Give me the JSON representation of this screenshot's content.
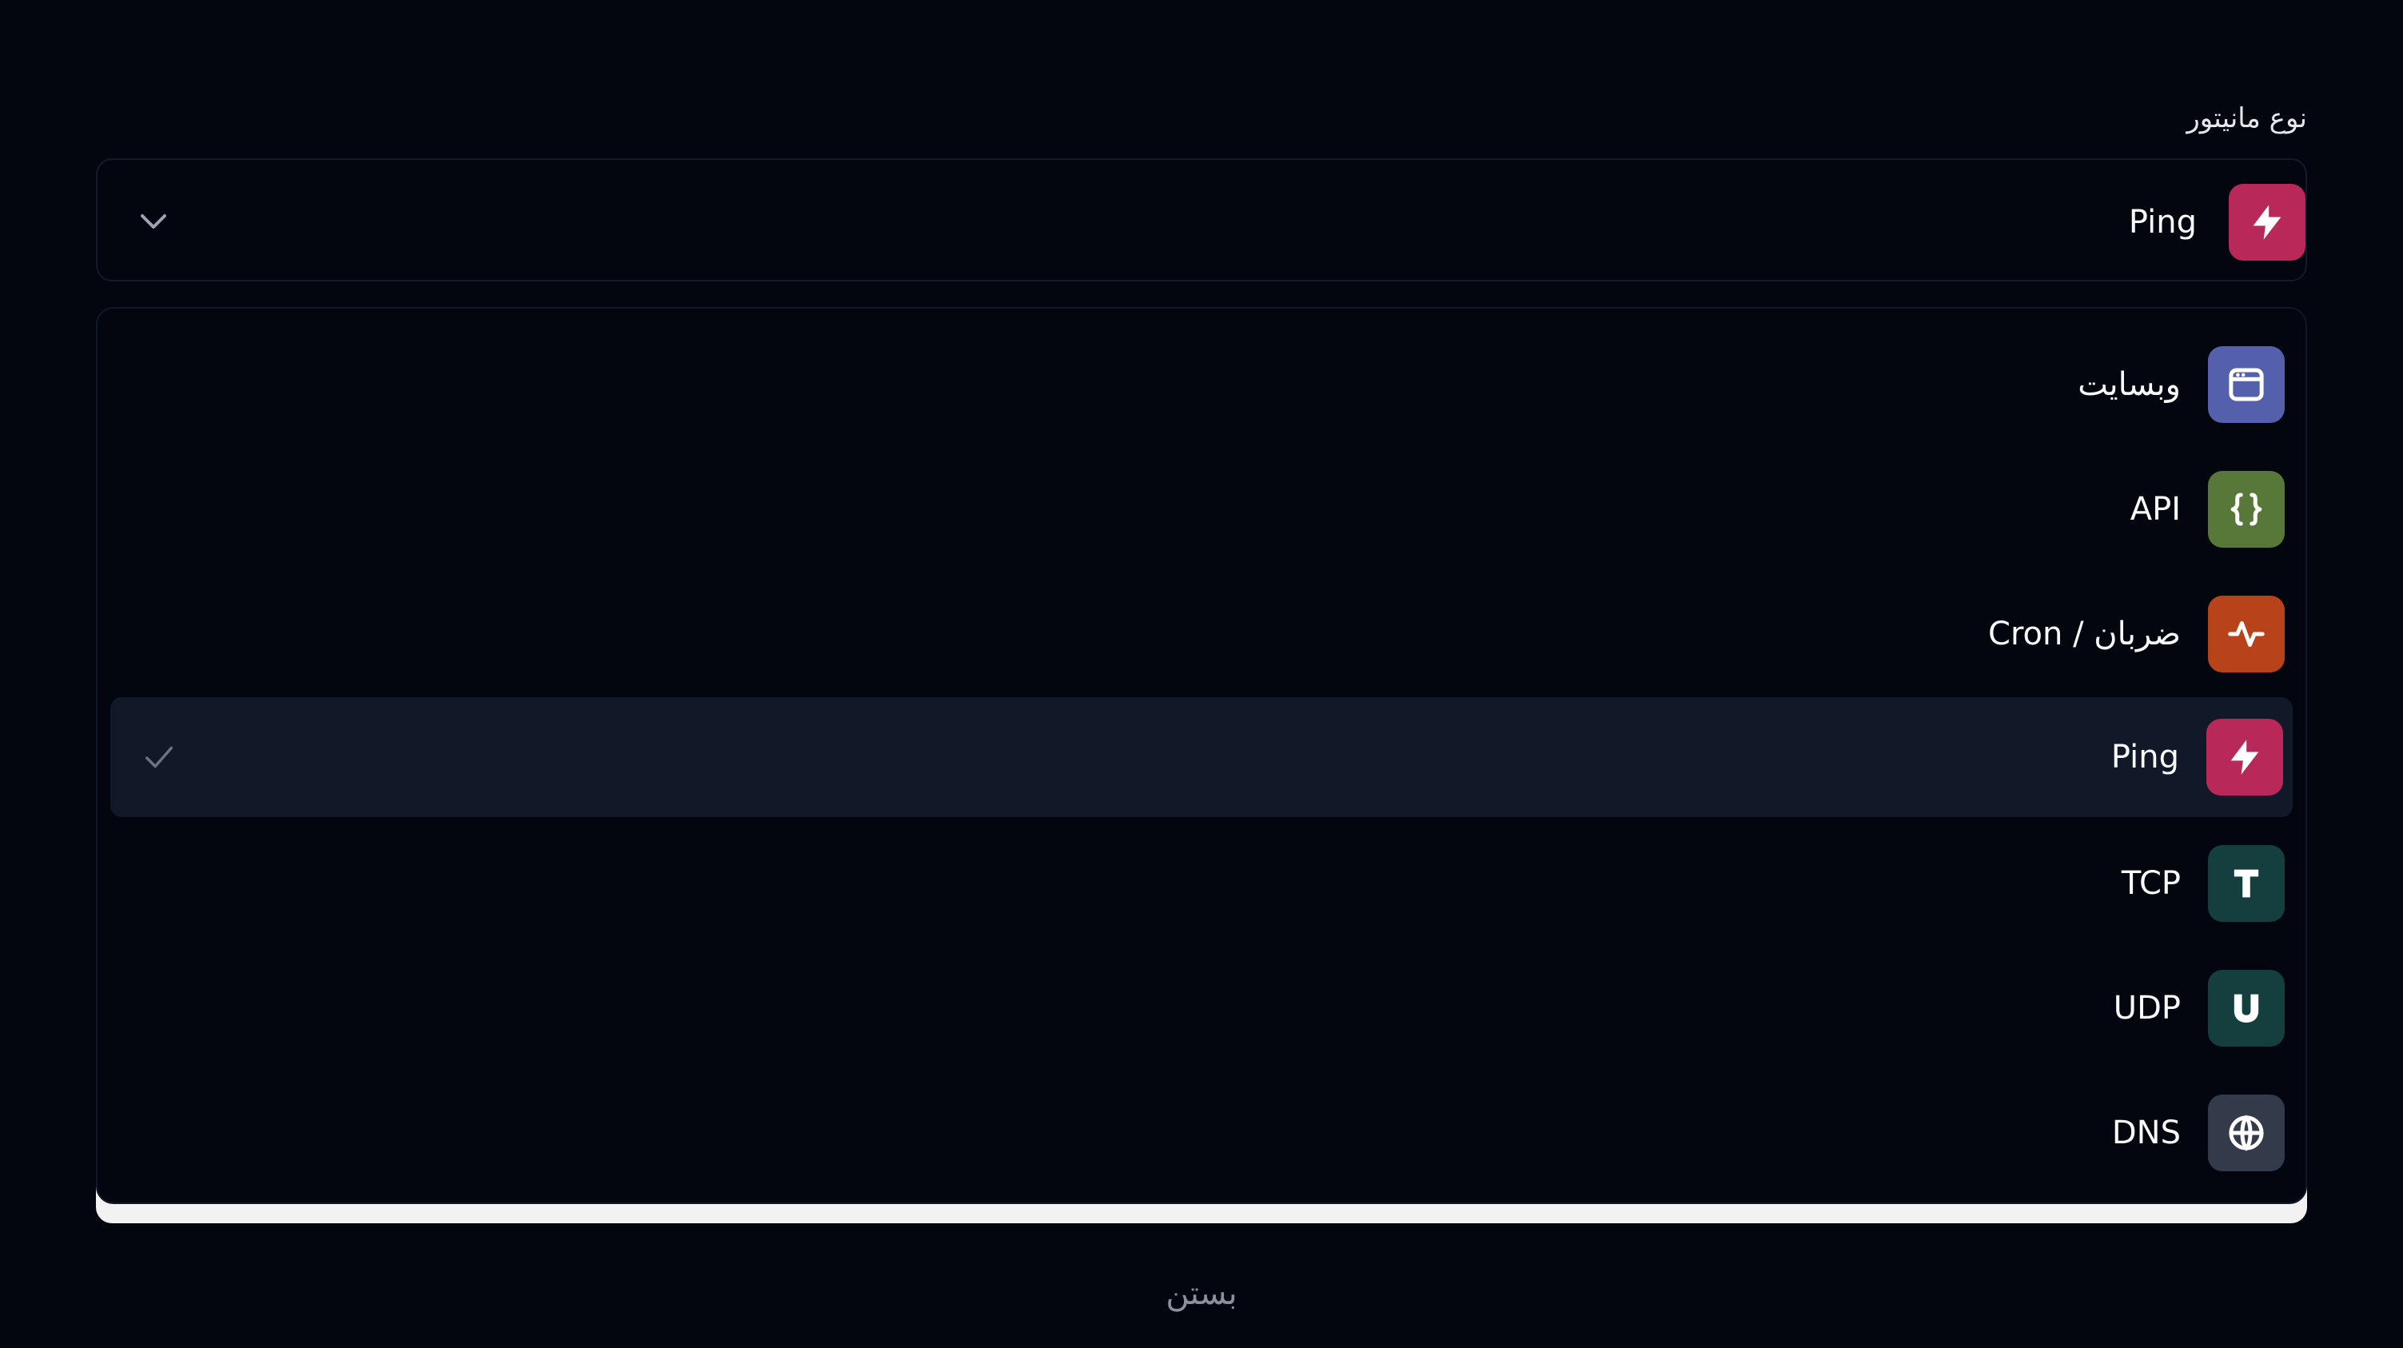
{
  "form": {
    "field_label": "نوع مانیتور",
    "selected": {
      "label": "Ping",
      "icon": "lightning-bolt-icon",
      "color": "#b8295a"
    },
    "chevron_icon": "chevron-down-icon"
  },
  "options": [
    {
      "label": "وبسایت",
      "icon": "browser-window-icon",
      "color": "#5460ac",
      "selected": false
    },
    {
      "label": "API",
      "icon": "curly-braces-icon",
      "color": "#58783a",
      "selected": false
    },
    {
      "label": "Cron / ضربان",
      "icon": "heartbeat-pulse-icon",
      "color": "#b8431a",
      "selected": false
    },
    {
      "label": "Ping",
      "icon": "lightning-bolt-icon",
      "color": "#b8295a",
      "selected": true
    },
    {
      "label": "TCP",
      "icon": "letter-t-icon",
      "color": "#153f3f",
      "selected": false
    },
    {
      "label": "UDP",
      "icon": "letter-u-icon",
      "color": "#153f3f",
      "selected": false
    },
    {
      "label": "DNS",
      "icon": "globe-icon",
      "color": "#333a4a",
      "selected": false
    }
  ],
  "footer": {
    "close_label": "بستن"
  },
  "colors": {
    "background": "#03060f",
    "selected_row": "#111827",
    "border": "#131a2a",
    "check": "#6b7280"
  }
}
